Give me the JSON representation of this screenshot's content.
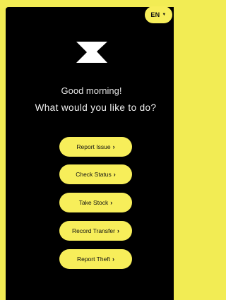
{
  "header": {
    "language": "EN",
    "language_caret_icon": "caret-down-icon",
    "logo_icon": "brand-z-logo-icon"
  },
  "greeting": "Good morning!",
  "question": "What would you like to do?",
  "actions": [
    {
      "label": "Report Issue",
      "icon": "chevron-right-icon"
    },
    {
      "label": "Check Status",
      "icon": "chevron-right-icon"
    },
    {
      "label": "Take Stock",
      "icon": "chevron-right-icon"
    },
    {
      "label": "Record Transfer",
      "icon": "chevron-right-icon"
    },
    {
      "label": "Report Theft",
      "icon": "chevron-right-icon"
    }
  ],
  "colors": {
    "accent": "#f7ee5a",
    "background": "#000000",
    "border": "#f2ec54"
  }
}
